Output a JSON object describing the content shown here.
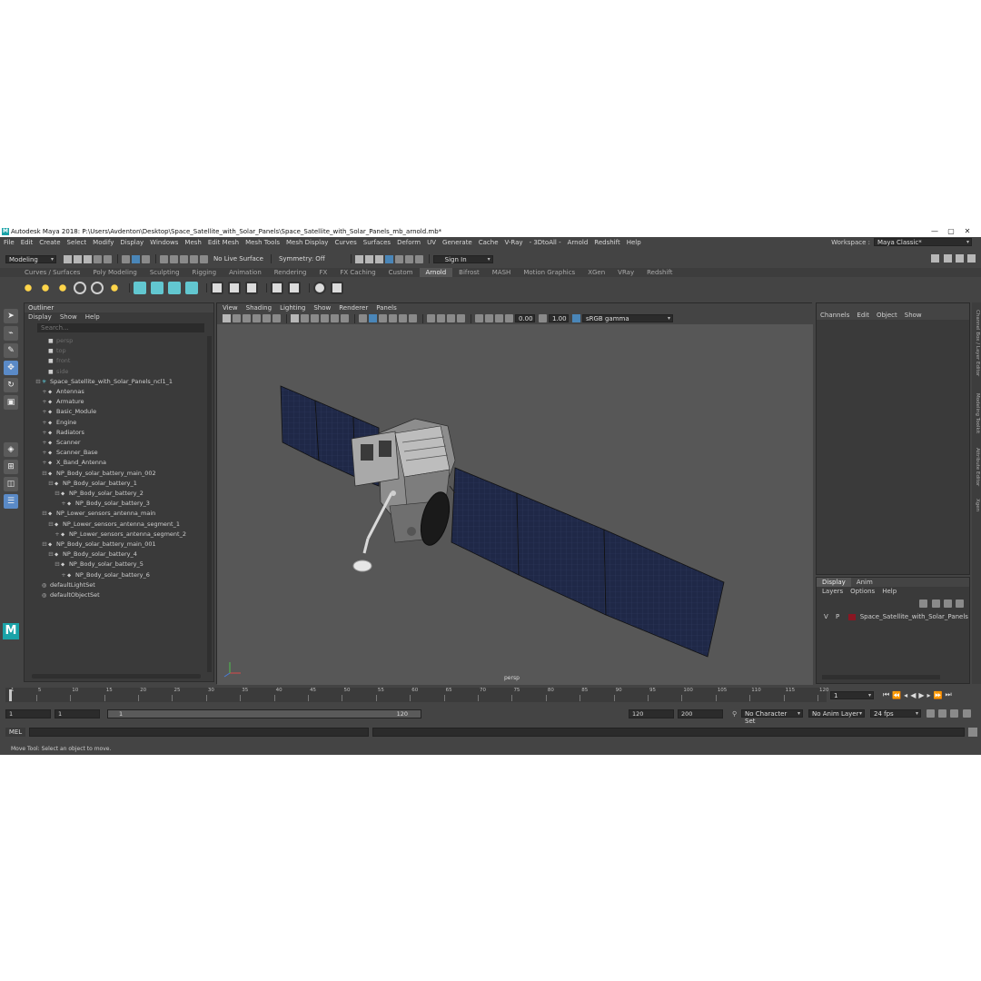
{
  "title_bar": {
    "app_icon": "maya-logo-icon",
    "title": "Autodesk Maya 2018: P:\\Users\\Avdenton\\Desktop\\Space_Satellite_with_Solar_Panels\\Space_Satellite_with_Solar_Panels_mb_arnold.mb*",
    "controls": [
      "—",
      "▢",
      "✕"
    ]
  },
  "menubar": {
    "items": [
      "File",
      "Edit",
      "Create",
      "Select",
      "Modify",
      "Display",
      "Windows",
      "Mesh",
      "Edit Mesh",
      "Mesh Tools",
      "Mesh Display",
      "Curves",
      "Surfaces",
      "Deform",
      "UV",
      "Generate",
      "Cache",
      "V-Ray",
      "- 3DtoAll -",
      "Arnold",
      "Redshift",
      "Help"
    ],
    "workspace_label": "Workspace :",
    "workspace_value": "Maya Classic*"
  },
  "statusline": {
    "mode": "Modeling",
    "live_surface": "No Live Surface",
    "symmetry": "Symmetry: Off",
    "sign_in": "Sign In"
  },
  "shelf_tabs": {
    "items": [
      "Curves / Surfaces",
      "Poly Modeling",
      "Sculpting",
      "Rigging",
      "Animation",
      "Rendering",
      "FX",
      "FX Caching",
      "Custom",
      "Arnold",
      "Bifrost",
      "MASH",
      "Motion Graphics",
      "XGen",
      "VRay",
      "Redshift"
    ],
    "active": "Arnold"
  },
  "outliner": {
    "title": "Outliner",
    "menu": [
      "Display",
      "Show",
      "Help"
    ],
    "search_placeholder": "Search...",
    "items": [
      {
        "label": "persp",
        "depth": 2,
        "icon": "camera-icon",
        "dim": true,
        "expander": ""
      },
      {
        "label": "top",
        "depth": 2,
        "icon": "camera-icon",
        "dim": true,
        "expander": ""
      },
      {
        "label": "front",
        "depth": 2,
        "icon": "camera-icon",
        "dim": true,
        "expander": ""
      },
      {
        "label": "side",
        "depth": 2,
        "icon": "camera-icon",
        "dim": true,
        "expander": ""
      },
      {
        "label": "Space_Satellite_with_Solar_Panels_ncl1_1",
        "depth": 1,
        "icon": "group-asterisk-icon",
        "dim": false,
        "expander": "⊟"
      },
      {
        "label": "Antennas",
        "depth": 2,
        "icon": "transform-icon",
        "dim": false,
        "expander": "+"
      },
      {
        "label": "Armature",
        "depth": 2,
        "icon": "transform-icon",
        "dim": false,
        "expander": "+"
      },
      {
        "label": "Basic_Module",
        "depth": 2,
        "icon": "transform-icon",
        "dim": false,
        "expander": "+"
      },
      {
        "label": "Engine",
        "depth": 2,
        "icon": "transform-icon",
        "dim": false,
        "expander": "+"
      },
      {
        "label": "Radiators",
        "depth": 2,
        "icon": "transform-icon",
        "dim": false,
        "expander": "+"
      },
      {
        "label": "Scanner",
        "depth": 2,
        "icon": "transform-icon",
        "dim": false,
        "expander": "+"
      },
      {
        "label": "Scanner_Base",
        "depth": 2,
        "icon": "transform-icon",
        "dim": false,
        "expander": "+"
      },
      {
        "label": "X_Band_Antenna",
        "depth": 2,
        "icon": "transform-icon",
        "dim": false,
        "expander": "+"
      },
      {
        "label": "NP_Body_solar_battery_main_002",
        "depth": 2,
        "icon": "transform-icon",
        "dim": false,
        "expander": "⊟"
      },
      {
        "label": "NP_Body_solar_battery_1",
        "depth": 3,
        "icon": "transform-icon",
        "dim": false,
        "expander": "⊟"
      },
      {
        "label": "NP_Body_solar_battery_2",
        "depth": 4,
        "icon": "transform-icon",
        "dim": false,
        "expander": "⊟"
      },
      {
        "label": "NP_Body_solar_battery_3",
        "depth": 5,
        "icon": "transform-icon",
        "dim": false,
        "expander": "+"
      },
      {
        "label": "NP_Lower_sensors_antenna_main",
        "depth": 2,
        "icon": "transform-icon",
        "dim": false,
        "expander": "⊟"
      },
      {
        "label": "NP_Lower_sensors_antenna_segment_1",
        "depth": 3,
        "icon": "transform-icon",
        "dim": false,
        "expander": "⊟"
      },
      {
        "label": "NP_Lower_sensors_antenna_segment_2",
        "depth": 4,
        "icon": "transform-icon",
        "dim": false,
        "expander": "+"
      },
      {
        "label": "NP_Body_solar_battery_main_001",
        "depth": 2,
        "icon": "transform-icon",
        "dim": false,
        "expander": "⊟"
      },
      {
        "label": "NP_Body_solar_battery_4",
        "depth": 3,
        "icon": "transform-icon",
        "dim": false,
        "expander": "⊟"
      },
      {
        "label": "NP_Body_solar_battery_5",
        "depth": 4,
        "icon": "transform-icon",
        "dim": false,
        "expander": "⊟"
      },
      {
        "label": "NP_Body_solar_battery_6",
        "depth": 5,
        "icon": "transform-icon",
        "dim": false,
        "expander": "+"
      },
      {
        "label": "defaultLightSet",
        "depth": 1,
        "icon": "set-icon",
        "dim": false,
        "expander": ""
      },
      {
        "label": "defaultObjectSet",
        "depth": 1,
        "icon": "set-icon",
        "dim": false,
        "expander": ""
      }
    ]
  },
  "viewport": {
    "menu": [
      "View",
      "Shading",
      "Lighting",
      "Show",
      "Renderer",
      "Panels"
    ],
    "exposure": "0.00",
    "gamma": "1.00",
    "color_space": "sRGB gamma",
    "camera_label": "persp"
  },
  "channel_box": {
    "menu": [
      "Channels",
      "Edit",
      "Object",
      "Show"
    ]
  },
  "layer_editor": {
    "tabs": [
      "Display",
      "Anim"
    ],
    "active_tab": "Display",
    "menu": [
      "Layers",
      "Options",
      "Help"
    ],
    "layer": {
      "visible": "V",
      "playback": "P",
      "name": "Space_Satellite_with_Solar_Panels",
      "color": "#8a1622"
    }
  },
  "side_tabs": [
    "Channel Box / Layer Editor",
    "Modeling Toolkit",
    "Attribute Editor",
    "Xgen"
  ],
  "time_slider": {
    "ticks": [
      "1",
      "5",
      "10",
      "15",
      "20",
      "25",
      "30",
      "35",
      "40",
      "45",
      "50",
      "55",
      "60",
      "65",
      "70",
      "75",
      "80",
      "85",
      "90",
      "95",
      "100",
      "105",
      "110",
      "115",
      "120"
    ],
    "current_frame": "1"
  },
  "range_bar": {
    "start": "1",
    "playback_start": "1",
    "slider_start": "1",
    "slider_end": "120",
    "playback_end": "120",
    "end": "200",
    "character_set": "No Character Set",
    "anim_layer": "No Anim Layer",
    "fps": "24 fps"
  },
  "command_line": {
    "label": "MEL"
  },
  "help_line": {
    "text": "Move Tool: Select an object to move."
  }
}
